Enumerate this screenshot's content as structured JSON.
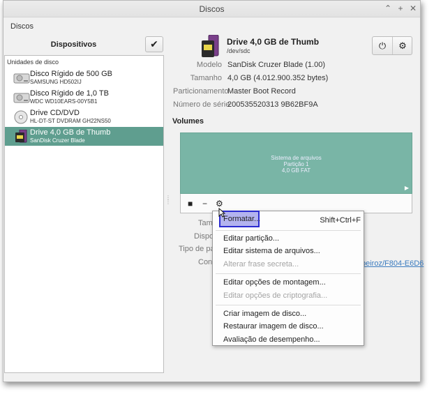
{
  "window": {
    "title": "Discos"
  },
  "menubar": {
    "item": "Discos"
  },
  "left": {
    "header": "Dispositivos",
    "section": "Unidades de disco",
    "devices": [
      {
        "name": "Disco Rígido de 500 GB",
        "sub": "SAMSUNG HD502IJ",
        "icon": "hard-disk-icon"
      },
      {
        "name": "Disco Rígido de 1,0 TB",
        "sub": "WDC WD10EARS-00Y5B1",
        "icon": "hard-disk-icon"
      },
      {
        "name": "Drive CD/DVD",
        "sub": "HL-DT-ST DVDRAM GH22NS50",
        "icon": "optical-disc-icon"
      },
      {
        "name": "Drive 4,0 GB de Thumb",
        "sub": "SanDisk Cruzer Blade",
        "icon": "usb-drive-icon",
        "selected": true
      }
    ]
  },
  "drive": {
    "title": "Drive 4,0 GB de Thumb",
    "device": "/dev/sdc",
    "props": [
      {
        "label": "Modelo",
        "value": "SanDisk Cruzer Blade (1.00)"
      },
      {
        "label": "Tamanho",
        "value": "4,0 GB (4.012.900.352 bytes)"
      },
      {
        "label": "Particionamento",
        "value": "Master Boot Record"
      },
      {
        "label": "Número de série",
        "value": "200535520313 9B62BF9A"
      }
    ]
  },
  "volumes": {
    "title": "Volumes",
    "partition": {
      "line1": "Sistema de arquivos",
      "line2": "Partição 1",
      "line3": "4,0 GB FAT"
    },
    "partial_labels": [
      "Tam",
      "Dispos",
      "Tipo de par",
      "Cont"
    ],
    "partial_link": "peiroz/F804-E6D6"
  },
  "context_menu": {
    "items": [
      {
        "label": "Formatar...",
        "accel": "Shift+Ctrl+F",
        "disabled": false
      },
      {
        "label": "Editar partição...",
        "disabled": false
      },
      {
        "label": "Editar sistema de arquivos...",
        "disabled": false
      },
      {
        "label": "Alterar frase secreta...",
        "disabled": true
      },
      {
        "label": "Editar opções de montagem...",
        "disabled": false
      },
      {
        "label": "Editar opções de criptografia...",
        "disabled": true
      },
      {
        "label": "Criar imagem de disco...",
        "disabled": false
      },
      {
        "label": "Restaurar imagem de disco...",
        "disabled": false
      },
      {
        "label": "Avaliação de desempenho...",
        "disabled": false
      }
    ]
  },
  "colors": {
    "selection": "#5f9e8f",
    "partition": "#79b5a6",
    "highlight": "#b3b3ef",
    "link": "#3a7bbf"
  }
}
